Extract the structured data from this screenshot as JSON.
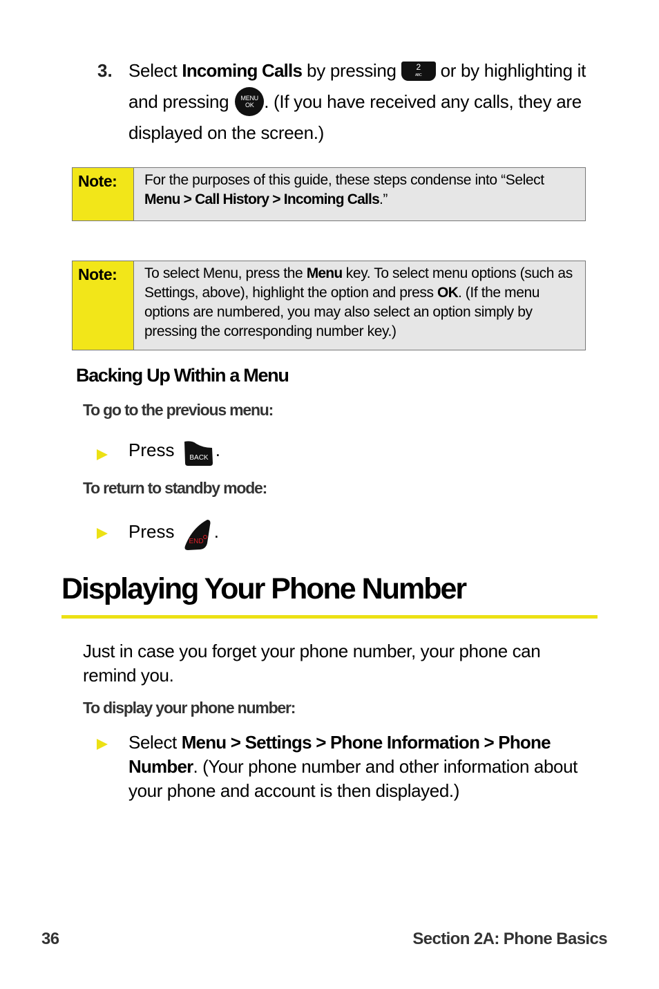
{
  "step3": {
    "number": "3.",
    "t1": "Select ",
    "b1": "Incoming Calls",
    "t2": " by pressing ",
    "key2_number": "2",
    "key2_letters": "ABC",
    "t3": " or by highlighting it and pressing ",
    "menu_key_top": "MENU",
    "menu_key_bottom": "OK",
    "t4": ". (If you have received any calls, they are displayed on the screen.)"
  },
  "note1": {
    "label": "Note:",
    "t1": "For the purposes of this guide, these steps condense into “Select ",
    "b1": "Menu > Call History > Incoming Calls",
    "t2": ".”"
  },
  "note2": {
    "label": "Note:",
    "t1": "To select Menu, press the ",
    "b1": "Menu",
    "t2": " key. To select menu options (such as Settings, above), highlight the option and press ",
    "b2": "OK",
    "t3": ". (If the menu options are numbered, you may also select an option simply by pressing the corresponding number key.)"
  },
  "backing_up": {
    "heading": "Backing Up Within a Menu",
    "sub1": "To go to the previous menu:",
    "bullet1_text": "Press",
    "back_key_label": "BACK",
    "bullet1_end": ".",
    "sub2": "To return to standby mode:",
    "bullet2_text": "Press",
    "end_key_label": "END",
    "bullet2_end": "."
  },
  "section": {
    "title": "Displaying Your Phone Number",
    "intro": "Just in case you forget your phone number, your phone can remind you.",
    "sub": "To display your phone number:",
    "bullet_t1": "Select ",
    "bullet_b1": "Menu > Settings > Phone Information > Phone Number",
    "bullet_t2": ". (Your phone number and other information about your phone and account is then displayed.)"
  },
  "footer": {
    "page_number": "36",
    "section_label": "Section 2A: Phone Basics"
  },
  "colors": {
    "accent_yellow": "#f2e619",
    "note_background": "#e6e6e6"
  }
}
